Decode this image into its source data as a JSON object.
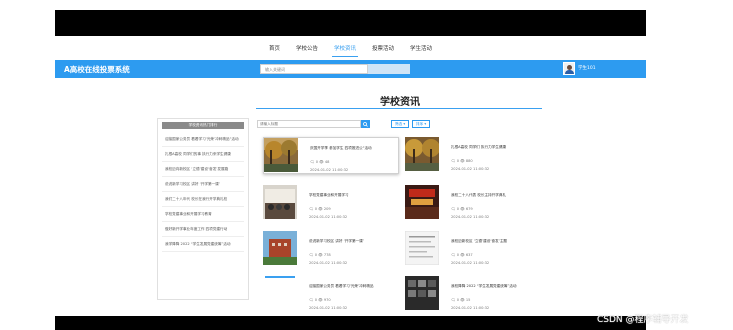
{
  "nav": {
    "items": [
      "首页",
      "学校公告",
      "学校资讯",
      "投票活动",
      "学生活动"
    ],
    "active_index": 2
  },
  "header": {
    "site_title": "A高校在线投票系统",
    "search_placeholder": "输入关键词",
    "user_name": "学生101"
  },
  "page": {
    "title": "学校资讯"
  },
  "sidebar": {
    "header": "学校资讯热门排行",
    "items": [
      "迎接国家公务员 看看学习‘光荣’冲刺精品“活动",
      "扎根A高校 同学们的事 执行力来学生健康",
      "我校迈向新校区 ‘立德’建设‘奋发’发展路",
      "说说新学习校区 讲好 ‘开学第一课’",
      "我们二十八年代 校长在我行开学典礼校",
      "学校党建事业和开展学习教育",
      "做好新开学事业年度工作 四项党建行动",
      "我学降降 2022 “学生发展党建统筹”活动"
    ]
  },
  "toolbar": {
    "search_placeholder": "请输入标题",
    "dropdown_1": "筛选 ▾",
    "dropdown_2": "排序 ▾"
  },
  "cards": [
    {
      "title": "庆国开学季 参加学生 四项推进公“活动",
      "stats": "🗨 0   👁 48",
      "date": "2024-01-02 11:00:32"
    },
    {
      "title": "扎根A高校 同学们 执行力学生健康",
      "stats": "🗨 0   👁 880",
      "date": "2024-01-02 11:00:32"
    },
    {
      "title": "学校党建事业和开展学习",
      "stats": "🗨 0   👁 209",
      "date": "2024-01-02 11:00:32"
    },
    {
      "title": "我校二十八代表 校长主持开学典礼",
      "stats": "🗨 0   👁 679",
      "date": "2024-01-02 11:00:32"
    },
    {
      "title": "说说新学习校区 讲好 ‘开学第一课’",
      "stats": "🗨 0   👁 778",
      "date": "2024-01-02 11:00:32"
    },
    {
      "title": "我校迈新校区 ‘立德’建设‘奋发’主题",
      "stats": "🗨 0   👁 637",
      "date": "2024-01-02 11:00:32"
    },
    {
      "title": "迎接国家公务员 看看学习‘光荣’冲刺精品",
      "stats": "🗨 0   👁 970",
      "date": "2024-01-02 11:00:32"
    },
    {
      "title": "我校降降 2022 “学生发展党建统筹”活动",
      "stats": "🗨 0   👁 15",
      "date": "2024-01-02 11:00:32"
    }
  ],
  "watermark": "CSDN @程序辅导开发",
  "colors": {
    "accent": "#2d9bf0",
    "header_bg": "#2d9bf0"
  }
}
